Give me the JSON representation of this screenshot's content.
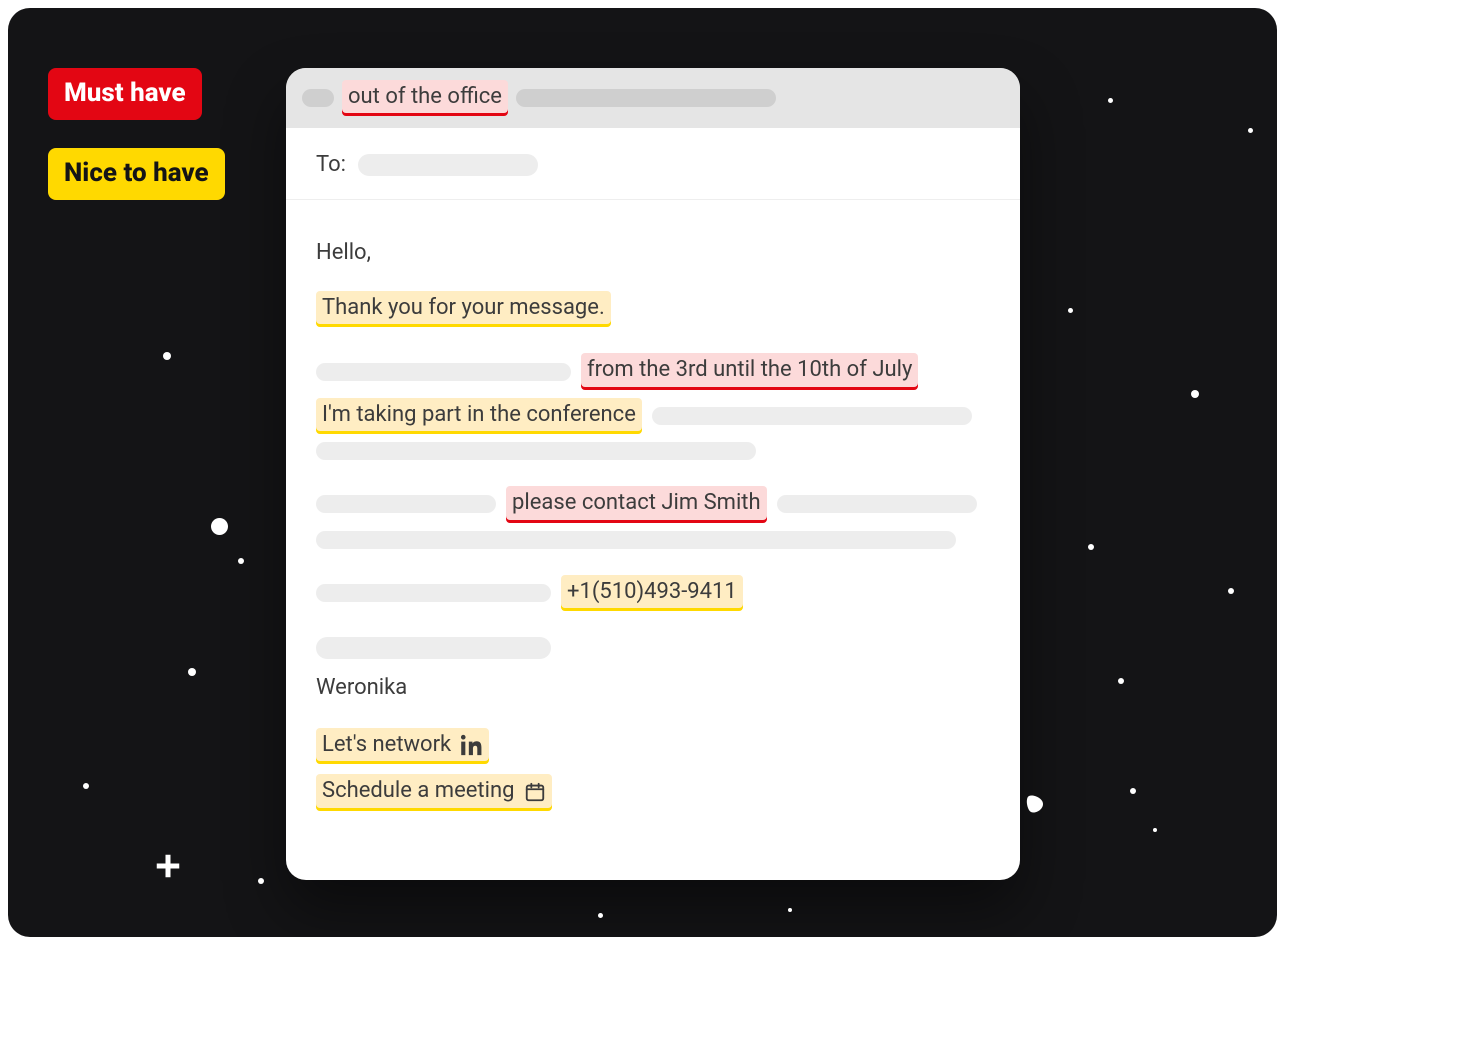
{
  "legend": {
    "must_label": "Must have",
    "nice_label": "Nice to have"
  },
  "email": {
    "subject_highlight": "out of the office",
    "to_label": "To:",
    "body": {
      "greeting": "Hello,",
      "thanks": "Thank you for your message.",
      "dates_highlight": "from the 3rd until the 10th of July",
      "conference_highlight": "I'm taking part in the conference",
      "contact_highlight": "please contact Jim Smith",
      "phone_highlight": "+1(510)493-9411",
      "sender_name": "Weronika",
      "network_label": "Let's network",
      "schedule_label": "Schedule a meeting"
    }
  }
}
